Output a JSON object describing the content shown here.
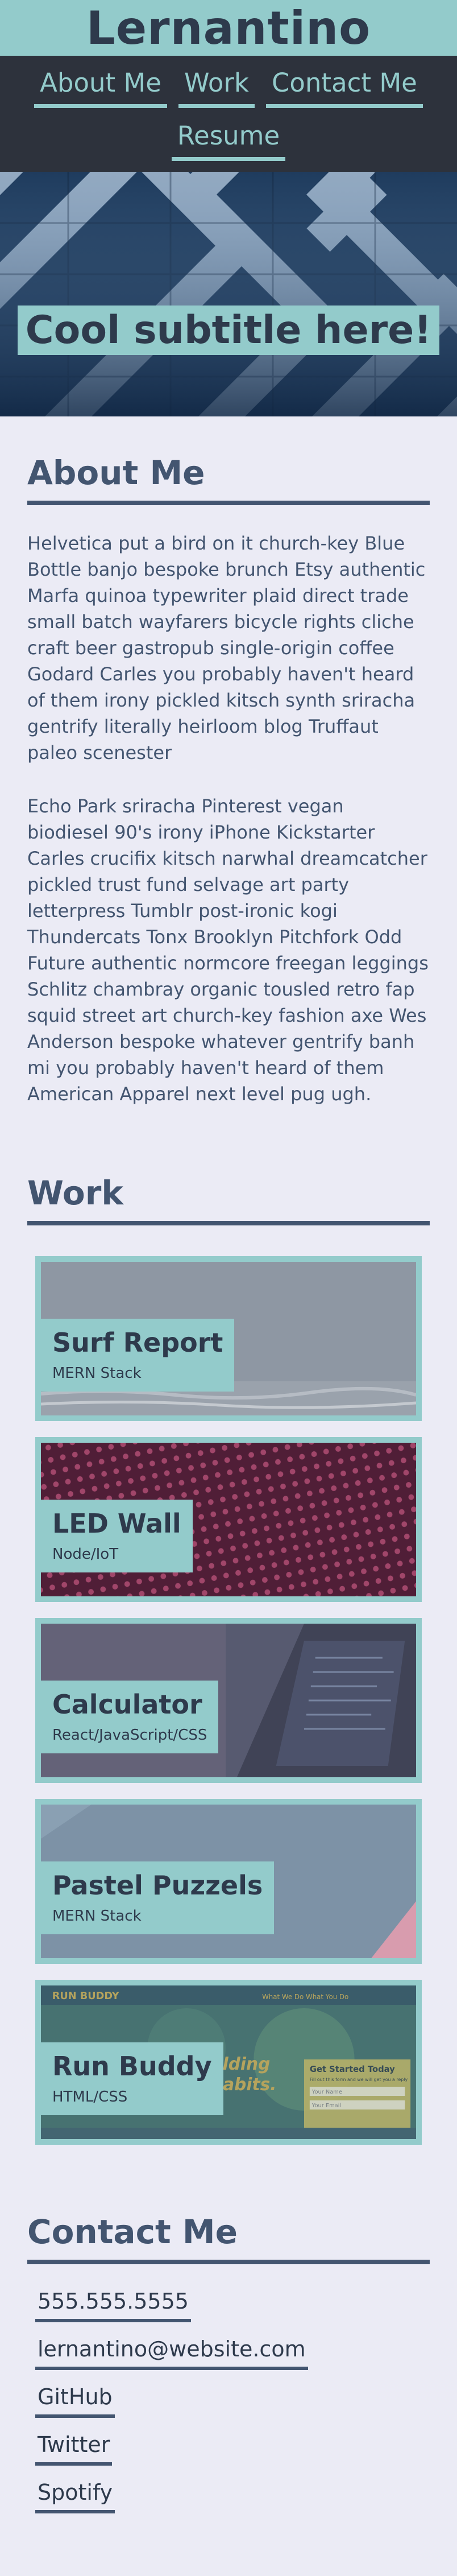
{
  "site": {
    "title": "Lernantino"
  },
  "nav": {
    "items": [
      {
        "label": "About Me"
      },
      {
        "label": "Work"
      },
      {
        "label": "Contact Me"
      },
      {
        "label": "Resume"
      }
    ]
  },
  "hero": {
    "subtitle": "Cool subtitle here!"
  },
  "about": {
    "heading": "About Me",
    "paragraphs": [
      "Helvetica put a bird on it church-key Blue Bottle banjo bespoke brunch Etsy authentic Marfa quinoa typewriter plaid direct trade small batch wayfarers bicycle rights cliche craft beer gastropub single-origin coffee Godard Carles you probably haven't heard of them irony pickled kitsch synth sriracha gentrify literally heirloom blog Truffaut paleo scenester",
      "Echo Park sriracha Pinterest vegan biodiesel 90's irony iPhone Kickstarter Carles crucifix kitsch narwhal dreamcatcher pickled trust fund selvage art party letterpress Tumblr post-ironic kogi Thundercats Tonx Brooklyn Pitchfork Odd Future authentic normcore freegan leggings Schlitz chambray organic tousled retro fap squid street art church-key fashion axe Wes Anderson bespoke whatever gentrify banh mi you probably haven't heard of them American Apparel next level pug ugh."
    ]
  },
  "work": {
    "heading": "Work",
    "projects": [
      {
        "name": "Surf Report",
        "tech": "MERN Stack",
        "theme": "surf",
        "color": "#8c96a3"
      },
      {
        "name": "LED Wall",
        "tech": "Node/IoT",
        "theme": "led",
        "color": "#7a2a4a"
      },
      {
        "name": "Calculator",
        "tech": "React/JavaScript/CSS",
        "theme": "calc",
        "color": "#4a5566"
      },
      {
        "name": "Pastel Puzzels",
        "tech": "MERN Stack",
        "theme": "pastel",
        "color": "#7e93a6"
      },
      {
        "name": "Run Buddy",
        "tech": "HTML/CSS",
        "theme": "run",
        "color": "#4d7a6e",
        "overlay": {
          "brand": "RUN BUDDY",
          "nav": "What We Do  What You Do",
          "headline1": "Building",
          "headline2": "Habits.",
          "cta": "Get Started Today",
          "cta_sub": "Fill out this form and we will get you a reply",
          "field1": "Your Name",
          "field2": "Your Email"
        }
      }
    ]
  },
  "contact": {
    "heading": "Contact Me",
    "links": [
      {
        "label": "555.555.5555"
      },
      {
        "label": "lernantino@website.com"
      },
      {
        "label": "GitHub"
      },
      {
        "label": "Twitter"
      },
      {
        "label": "Spotify"
      }
    ]
  },
  "colors": {
    "accent": "#93cbcb",
    "nav_bg": "#2d323c",
    "text": "#435570",
    "page_bg": "#ebebf5"
  }
}
